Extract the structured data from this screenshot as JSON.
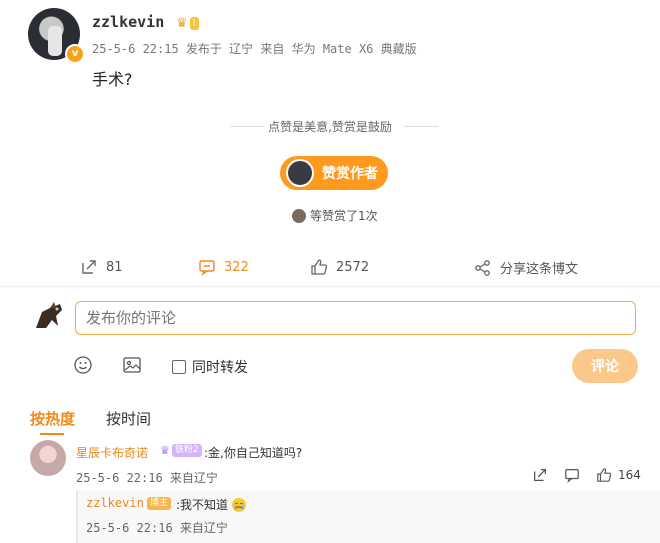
{
  "post": {
    "author": "zzlkevin",
    "level_badge": "I",
    "meta": "25-5-6 22:15 发布于 辽宁 来自 华为 Mate X6 典藏版",
    "text": "手术?"
  },
  "reward": {
    "tip": "点赞是美意,赞赏是鼓励",
    "button_label": "赞赏作者",
    "rewarded_text": "等赞赏了1次"
  },
  "actions": {
    "repost_count": "81",
    "comment_count": "322",
    "like_count": "2572",
    "share_label": "分享这条博文"
  },
  "composer": {
    "placeholder": "发布你的评论",
    "repost_label": "同时转发",
    "submit_label": "评论"
  },
  "sort": {
    "hot_label": "按热度",
    "time_label": "按时间"
  },
  "comments": [
    {
      "author": "星辰卡布奇诺",
      "fan_badge": "铁粉2",
      "text": ":金,你自己知道吗?",
      "meta": "25-5-6 22:16 来自辽宁",
      "like_count": "164",
      "reply": {
        "author": "zzlkevin",
        "tag": "博主",
        "text": ":我不知道",
        "meta": "25-5-6 22:16 来自辽宁"
      }
    }
  ],
  "colors": {
    "accent": "#f08a1c",
    "reward_button": "#ff9a1e",
    "submit_disabled": "#f9c88a"
  }
}
